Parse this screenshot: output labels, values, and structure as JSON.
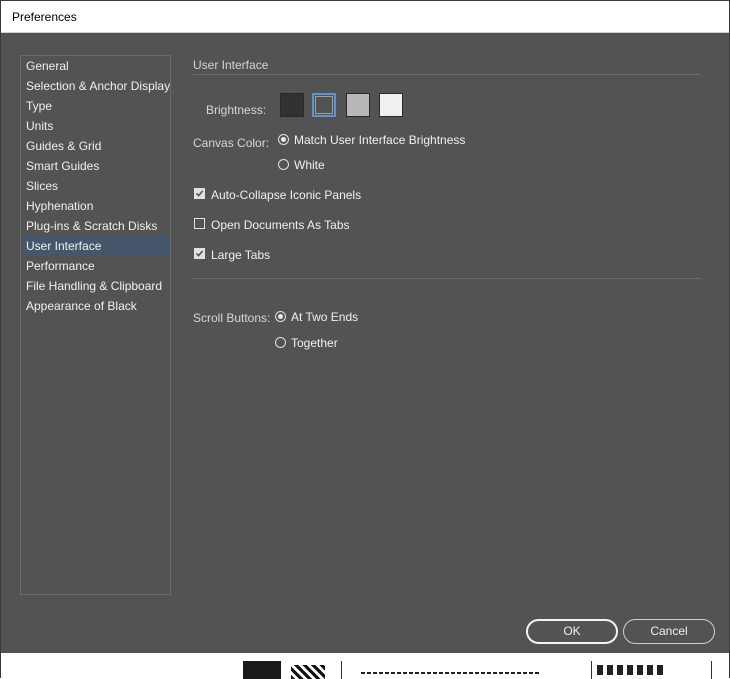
{
  "window": {
    "title": "Preferences"
  },
  "sidebar": {
    "items": [
      {
        "label": "General",
        "selected": false
      },
      {
        "label": "Selection & Anchor Display",
        "selected": false
      },
      {
        "label": "Type",
        "selected": false
      },
      {
        "label": "Units",
        "selected": false
      },
      {
        "label": "Guides & Grid",
        "selected": false
      },
      {
        "label": "Smart Guides",
        "selected": false
      },
      {
        "label": "Slices",
        "selected": false
      },
      {
        "label": "Hyphenation",
        "selected": false
      },
      {
        "label": "Plug-ins & Scratch Disks",
        "selected": false
      },
      {
        "label": "User Interface",
        "selected": true
      },
      {
        "label": "Performance",
        "selected": false
      },
      {
        "label": "File Handling & Clipboard",
        "selected": false
      },
      {
        "label": "Appearance of Black",
        "selected": false
      }
    ]
  },
  "main": {
    "section_title": "User Interface",
    "brightness": {
      "label": "Brightness:",
      "swatches": [
        {
          "name": "dark",
          "color": "#323232",
          "selected": false
        },
        {
          "name": "medium-dark",
          "color": "#535353",
          "selected": true
        },
        {
          "name": "medium-light",
          "color": "#b8b8b8",
          "selected": false
        },
        {
          "name": "light",
          "color": "#f0f0f0",
          "selected": false
        }
      ]
    },
    "canvas_color": {
      "label": "Canvas Color:",
      "options": [
        {
          "label": "Match User Interface Brightness",
          "checked": true
        },
        {
          "label": "White",
          "checked": false
        }
      ]
    },
    "checkboxes": [
      {
        "label": "Auto-Collapse Iconic Panels",
        "checked": true
      },
      {
        "label": "Open Documents As Tabs",
        "checked": false
      },
      {
        "label": "Large Tabs",
        "checked": true
      }
    ],
    "scroll_buttons": {
      "label": "Scroll Buttons:",
      "options": [
        {
          "label": "At Two Ends",
          "checked": true
        },
        {
          "label": "Together",
          "checked": false
        }
      ]
    }
  },
  "buttons": {
    "ok": "OK",
    "cancel": "Cancel"
  },
  "colors": {
    "panel_bg": "#535353",
    "selection_bg": "#46576c",
    "focus_accent": "#5b93d8"
  }
}
